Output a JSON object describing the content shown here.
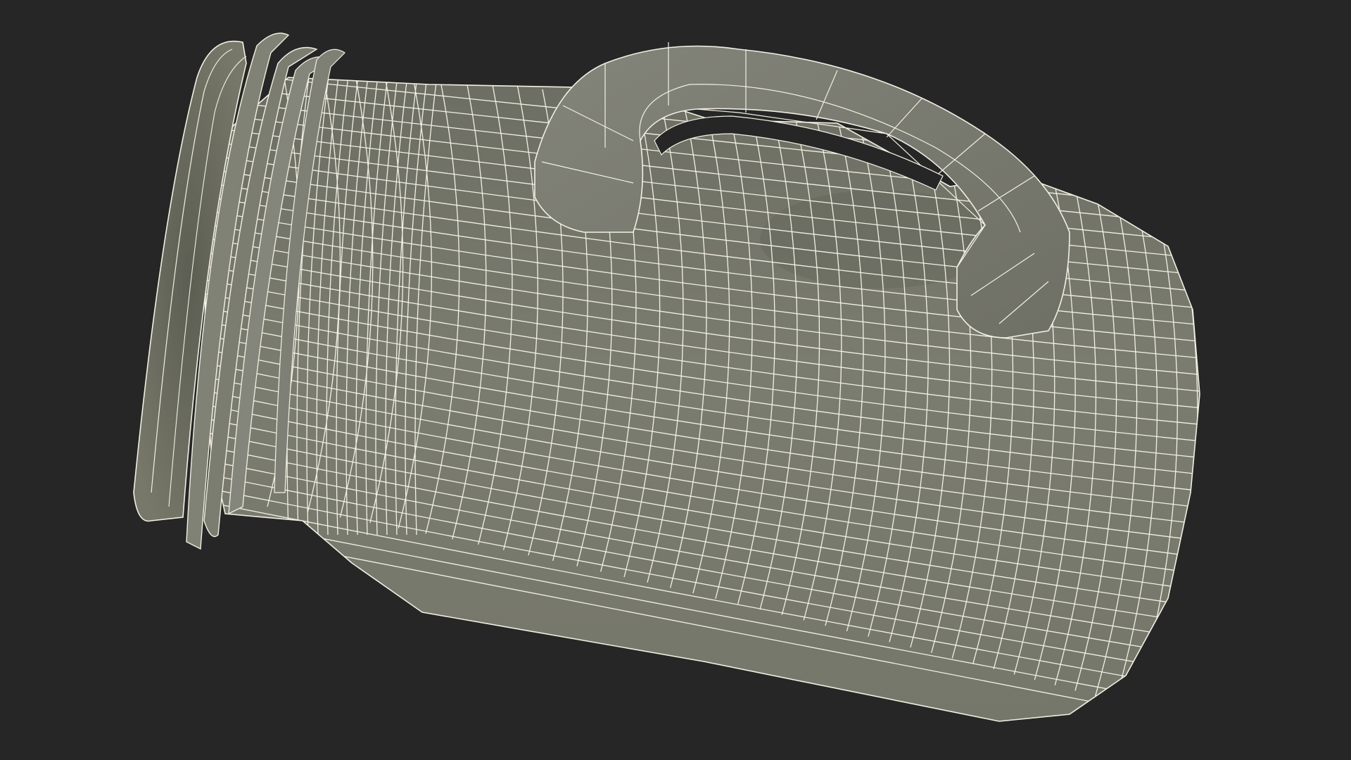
{
  "scene": {
    "subject": "wireframe-jug-model",
    "background_color": "#262626",
    "surface_color": "#7b7c70",
    "shadow_color": "#5f6156",
    "wire_color": "#f2f0e3"
  }
}
